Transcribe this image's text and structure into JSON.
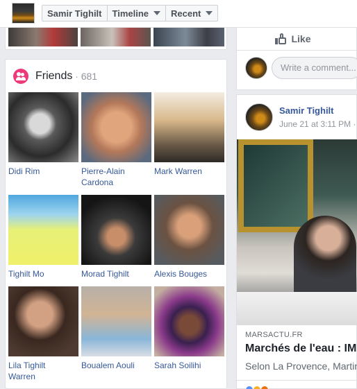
{
  "header": {
    "profile_name": "Samir Tighilt",
    "section_label": "Timeline",
    "sort_label": "Recent"
  },
  "friends": {
    "title": "Friends",
    "separator": "·",
    "count": "681",
    "people": [
      {
        "name": "Didi Rim"
      },
      {
        "name": "Pierre-Alain Cardona"
      },
      {
        "name": "Mark Warren"
      },
      {
        "name": "Tighilt Mo"
      },
      {
        "name": "Morad Tighilt"
      },
      {
        "name": "Alexis Bouges"
      },
      {
        "name": "Lila Tighilt Warren"
      },
      {
        "name": "Boualem Aouli"
      },
      {
        "name": "Sarah Soilihi"
      }
    ]
  },
  "post_top": {
    "like_label": "Like",
    "comment_placeholder": "Write a comment..."
  },
  "post": {
    "author": "Samir Tighilt",
    "time": "June 21 at 3:11 PM ·",
    "link_source": "MARSACTU.FR",
    "link_title": "Marchés de l'eau : IM",
    "link_desc": "Selon La Provence, Martin"
  },
  "colors": {
    "link_blue": "#365899",
    "friends_icon": "#ec3a7b",
    "reaction_colors": [
      "#5890ff",
      "#f7b125",
      "#e9710f"
    ]
  },
  "icons": [
    "friends-icon",
    "thumbs-up-icon",
    "globe-icon",
    "chevron-down-icon"
  ]
}
